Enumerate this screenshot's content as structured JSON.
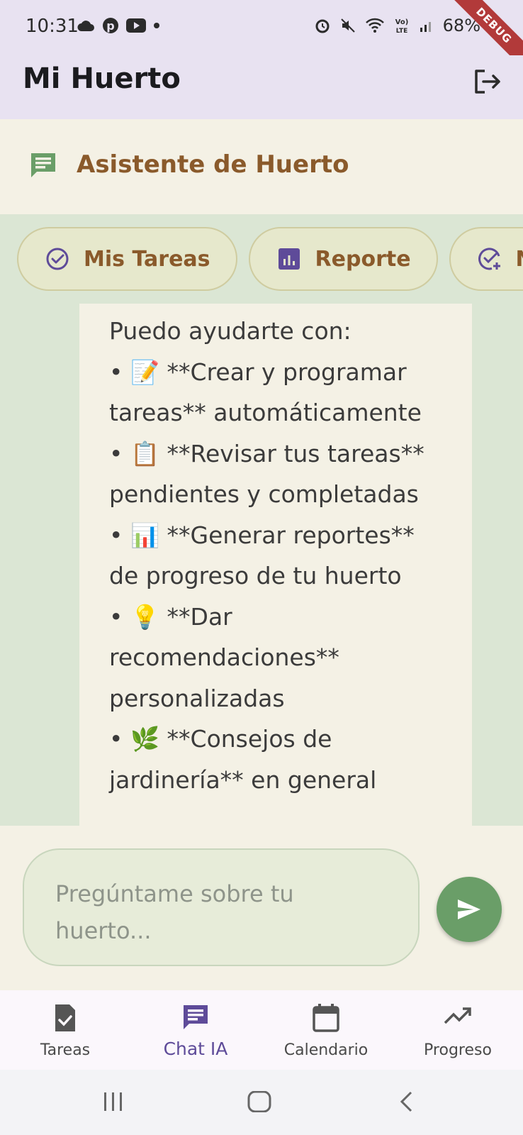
{
  "status_bar": {
    "time": "10:31",
    "battery": "68%",
    "debug_label": "DEBUG",
    "icons": [
      "cloud-icon",
      "pinterest-icon",
      "youtube-icon",
      "dot-icon",
      "alarm-icon",
      "mute-icon",
      "wifi-icon",
      "volte-icon",
      "signal-icon",
      "battery-icon"
    ]
  },
  "appbar": {
    "title": "Mi Huerto",
    "logout_icon": "logout-icon"
  },
  "assistant": {
    "title": "Asistente de Huerto",
    "icon": "chat-icon",
    "accent": "#8a5a2b"
  },
  "quick_actions": [
    {
      "label": "Mis Tareas",
      "icon": "check-circle-icon"
    },
    {
      "label": "Reporte",
      "icon": "bar-chart-icon"
    },
    {
      "label": "Nu",
      "icon": "add-task-icon"
    }
  ],
  "message": {
    "lines": [
      "Puedo ayudarte con:",
      "• 📝 **Crear y programar",
      "tareas** automáticamente",
      "• 📋 **Revisar tus tareas**",
      "pendientes y completadas",
      "• 📊 **Generar reportes**",
      "de progreso de tu huerto",
      "• 💡 **Dar",
      "recomendaciones**",
      "personalizadas",
      "• 🌿 **Consejos de",
      "jardinería** en general"
    ]
  },
  "input": {
    "placeholder_line1": "Pregúntame sobre tu",
    "placeholder_line2": "huerto...",
    "send_icon": "send-icon",
    "send_color": "#6a9e68"
  },
  "bottom_nav": [
    {
      "label": "Tareas",
      "icon": "task-icon",
      "active": false
    },
    {
      "label": "Chat IA",
      "icon": "chat-icon",
      "active": true
    },
    {
      "label": "Calendario",
      "icon": "calendar-icon",
      "active": false
    },
    {
      "label": "Progreso",
      "icon": "trending-up-icon",
      "active": false
    }
  ],
  "colors": {
    "primary": "#5e4b99",
    "header_bg": "#e8e2f1",
    "chat_bg": "#dbe6d4",
    "bubble_bg": "#f4f1e5"
  }
}
